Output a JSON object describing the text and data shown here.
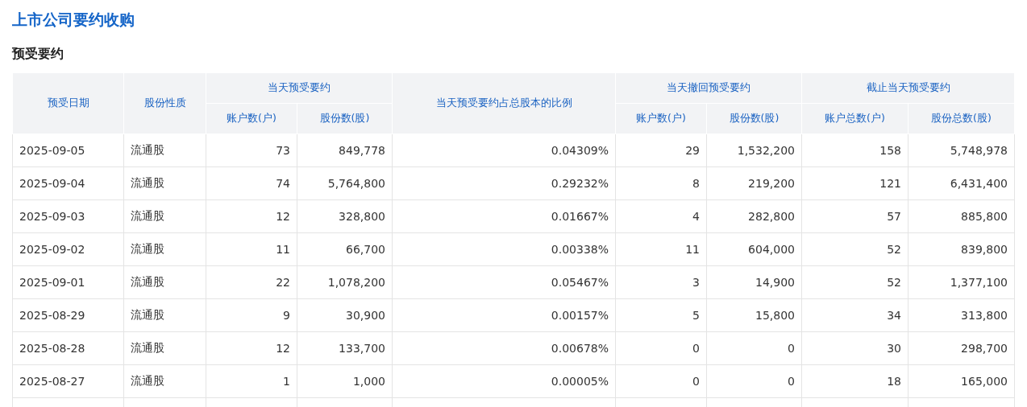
{
  "title": "上市公司要约收购",
  "section_title": "预受要约",
  "table": {
    "header_rows": [
      [
        {
          "label": "预受日期",
          "rowspan": 2
        },
        {
          "label": "股份性质",
          "rowspan": 2
        },
        {
          "label": "当天预受要约",
          "colspan": 2
        },
        {
          "label": "当天预受要约占总股本的比例",
          "rowspan": 2
        },
        {
          "label": "当天撤回预受要约",
          "colspan": 2
        },
        {
          "label": "截止当天预受要约",
          "colspan": 2
        }
      ],
      [
        {
          "label": "账户数(户)"
        },
        {
          "label": "股份数(股)"
        },
        {
          "label": "账户数(户)"
        },
        {
          "label": "股份数(股)"
        },
        {
          "label": "账户总数(户)"
        },
        {
          "label": "股份总数(股)"
        }
      ]
    ],
    "rows": [
      [
        "2025-09-05",
        "流通股",
        "73",
        "849,778",
        "0.04309%",
        "29",
        "1,532,200",
        "158",
        "5,748,978"
      ],
      [
        "2025-09-04",
        "流通股",
        "74",
        "5,764,800",
        "0.29232%",
        "8",
        "219,200",
        "121",
        "6,431,400"
      ],
      [
        "2025-09-03",
        "流通股",
        "12",
        "328,800",
        "0.01667%",
        "4",
        "282,800",
        "57",
        "885,800"
      ],
      [
        "2025-09-02",
        "流通股",
        "11",
        "66,700",
        "0.00338%",
        "11",
        "604,000",
        "52",
        "839,800"
      ],
      [
        "2025-09-01",
        "流通股",
        "22",
        "1,078,200",
        "0.05467%",
        "3",
        "14,900",
        "52",
        "1,377,100"
      ],
      [
        "2025-08-29",
        "流通股",
        "9",
        "30,900",
        "0.00157%",
        "5",
        "15,800",
        "34",
        "313,800"
      ],
      [
        "2025-08-28",
        "流通股",
        "12",
        "133,700",
        "0.00678%",
        "0",
        "0",
        "30",
        "298,700"
      ],
      [
        "2025-08-27",
        "流通股",
        "1",
        "1,000",
        "0.00005%",
        "0",
        "0",
        "18",
        "165,000"
      ]
    ]
  }
}
